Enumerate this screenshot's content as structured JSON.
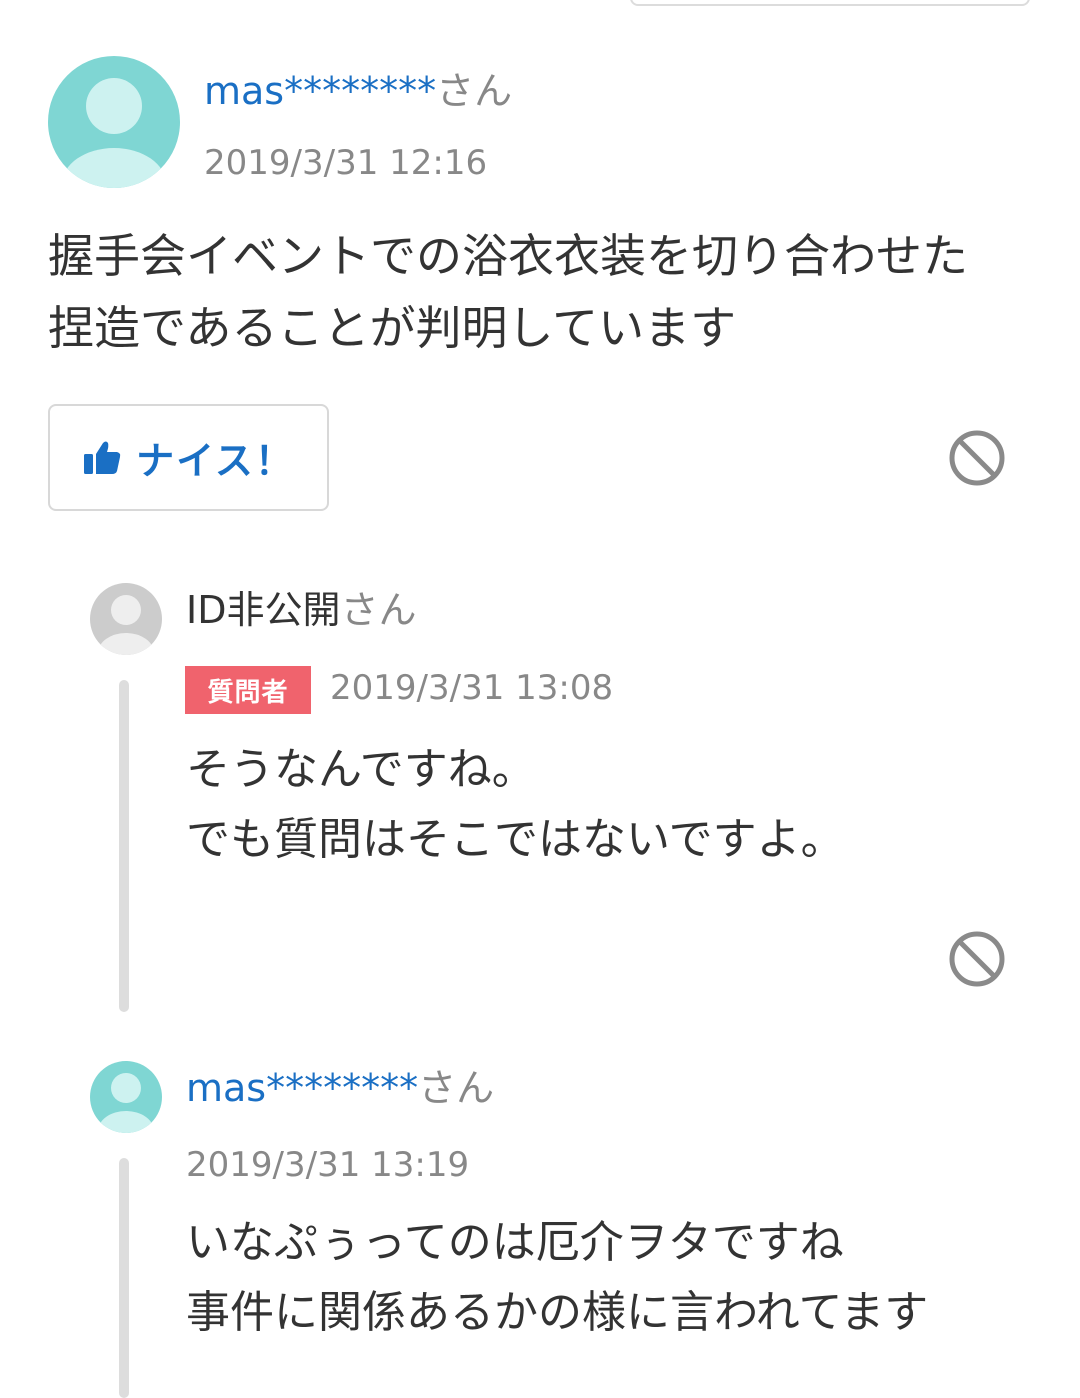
{
  "answer": {
    "user": {
      "handle": "mas********",
      "suffix": "さん"
    },
    "timestamp": "2019/3/31 12:16",
    "body_lines": [
      "握手会イベントでの浴衣衣装を切り合わせた",
      "捏造であることが判明しています"
    ],
    "nice_label": "ナイス！"
  },
  "replies": [
    {
      "user": {
        "handle": "ID非公開",
        "suffix": "さん"
      },
      "badge": "質問者",
      "timestamp": "2019/3/31 13:08",
      "body_lines": [
        "そうなんですね。",
        "でも質問はそこではないですよ。"
      ]
    },
    {
      "user": {
        "handle": "mas********",
        "suffix": "さん"
      },
      "timestamp": "2019/3/31 13:19",
      "body_lines": [
        "いなぷぅってのは厄介ヲタですね",
        "事件に関係あるかの様に言われてます"
      ]
    }
  ],
  "colors": {
    "link": "#1a6fc4",
    "badge": "#f0636d",
    "avatar_teal": "#7fd6d3",
    "avatar_gray": "#cccccc"
  },
  "icons": [
    "user-avatar-icon",
    "thumbs-up-icon",
    "block-icon"
  ]
}
